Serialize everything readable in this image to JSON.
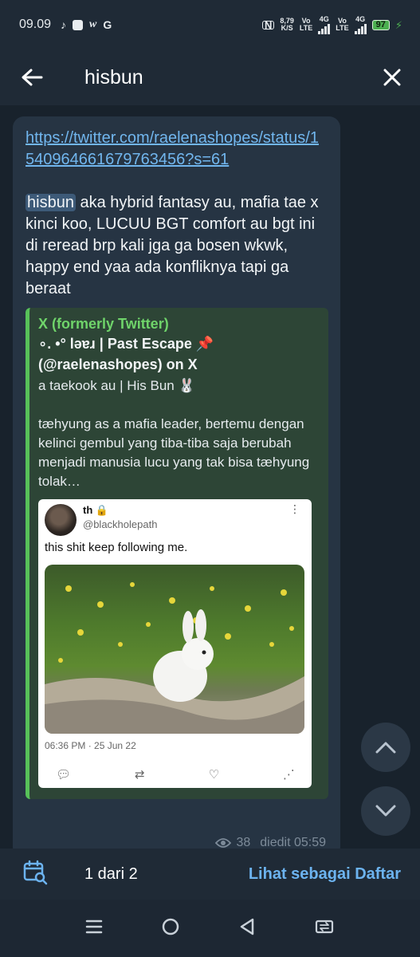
{
  "status_bar": {
    "time": "09.09",
    "net_speed_value": "8,79",
    "net_speed_unit": "K/S",
    "volte1": "Vo",
    "volte1_sub": "LTE",
    "net1": "4G",
    "volte2": "Vo",
    "volte2_sub": "LTE",
    "net2": "4G",
    "battery": "97"
  },
  "header": {
    "search_query": "hisbun"
  },
  "message": {
    "link": "https://twitter.com/raelenashopes/status/1540964661679763456?s=61",
    "highlight": "hisbun",
    "body": " aka hybrid fantasy au, mafia tae x kinci koo, LUCUU BGT comfort au bgt ini di reread brp kali jga ga bosen wkwk, happy end yaa ada konfliknya tapi ga beraat",
    "views": "38",
    "edited_time": "diedit 05:59"
  },
  "link_preview": {
    "site": "X (formerly Twitter)",
    "title": "∘. •° lǝɐɹ | Past Escape 📌 (@raelenashopes) on X",
    "description": "a taekook au | His Bun 🐰\n\ntæhyung as a mafia leader, bertemu dengan kelinci gembul yang tiba-tiba saja berubah menjadi manusia lucu yang tak bisa tæhyung tolak…"
  },
  "tweet": {
    "name": "th",
    "handle": "@blackholepath",
    "text": "this shit keep following me.",
    "timestamp": "06:36 PM · 25 Jun 22"
  },
  "bottom_bar": {
    "result_count": "1 dari 2",
    "list_view_label": "Lihat sebagai Daftar"
  },
  "colors": {
    "accent": "#6cb3ef",
    "preview_accent": "#57c159",
    "bubble": "#263443"
  }
}
